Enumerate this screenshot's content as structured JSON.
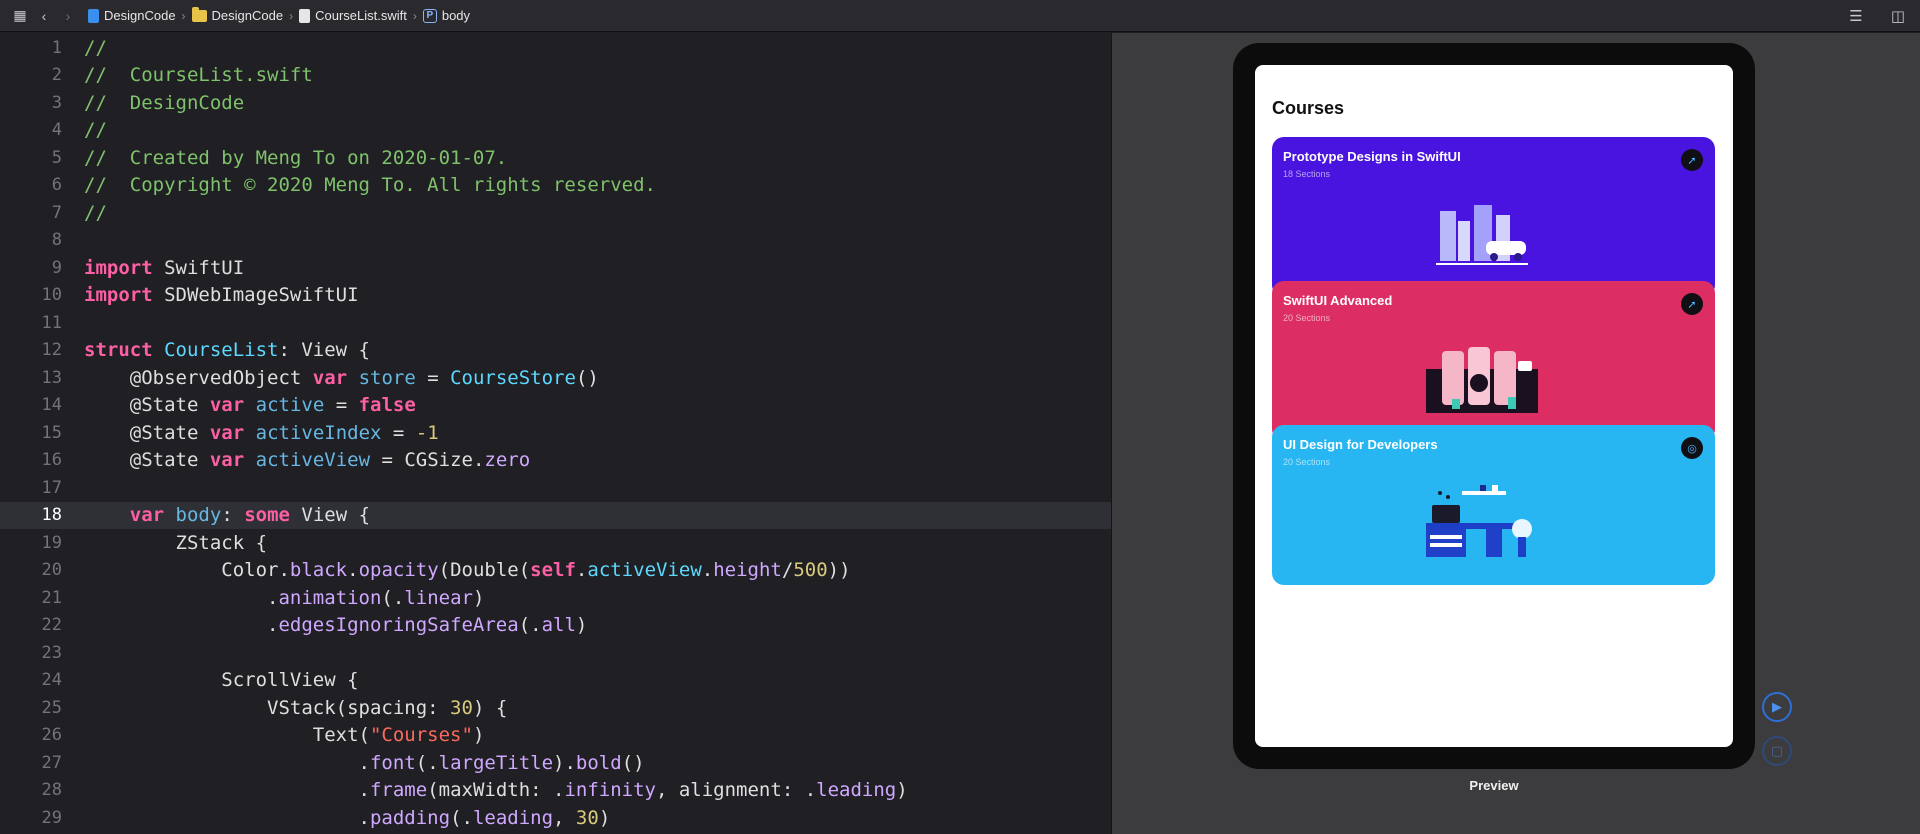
{
  "toolbar": {
    "breadcrumbs": [
      {
        "label": "DesignCode",
        "icon": "swift-project-icon"
      },
      {
        "label": "DesignCode",
        "icon": "folder-icon"
      },
      {
        "label": "CourseList.swift",
        "icon": "swift-file-icon"
      },
      {
        "label": "body",
        "icon": "property-icon"
      }
    ]
  },
  "editor": {
    "current_line": 18,
    "lines": [
      {
        "n": "1",
        "tokens": [
          [
            "cm",
            "//"
          ]
        ]
      },
      {
        "n": "2",
        "tokens": [
          [
            "cm",
            "//  CourseList.swift"
          ]
        ]
      },
      {
        "n": "3",
        "tokens": [
          [
            "cm",
            "//  DesignCode"
          ]
        ]
      },
      {
        "n": "4",
        "tokens": [
          [
            "cm",
            "//"
          ]
        ]
      },
      {
        "n": "5",
        "tokens": [
          [
            "cm",
            "//  Created by Meng To on 2020-01-07."
          ]
        ]
      },
      {
        "n": "6",
        "tokens": [
          [
            "cm",
            "//  Copyright © 2020 Meng To. All rights reserved."
          ]
        ]
      },
      {
        "n": "7",
        "tokens": [
          [
            "cm",
            "//"
          ]
        ]
      },
      {
        "n": "8",
        "tokens": []
      },
      {
        "n": "9",
        "tokens": [
          [
            "kw",
            "import"
          ],
          [
            "pl",
            " SwiftUI"
          ]
        ]
      },
      {
        "n": "10",
        "tokens": [
          [
            "kw",
            "import"
          ],
          [
            "pl",
            " SDWebImageSwiftUI"
          ]
        ]
      },
      {
        "n": "11",
        "tokens": []
      },
      {
        "n": "12",
        "tokens": [
          [
            "kw",
            "struct"
          ],
          [
            "pl",
            " "
          ],
          [
            "us",
            "CourseList"
          ],
          [
            "pl",
            ": View {"
          ]
        ]
      },
      {
        "n": "13",
        "tokens": [
          [
            "pl",
            "    @ObservedObject "
          ],
          [
            "kw",
            "var"
          ],
          [
            "pl",
            " "
          ],
          [
            "id",
            "store"
          ],
          [
            "pl",
            " = "
          ],
          [
            "us",
            "CourseStore"
          ],
          [
            "pl",
            "()"
          ]
        ]
      },
      {
        "n": "14",
        "tokens": [
          [
            "pl",
            "    @State "
          ],
          [
            "kw",
            "var"
          ],
          [
            "pl",
            " "
          ],
          [
            "id",
            "active"
          ],
          [
            "pl",
            " = "
          ],
          [
            "kw",
            "false"
          ]
        ]
      },
      {
        "n": "15",
        "tokens": [
          [
            "pl",
            "    @State "
          ],
          [
            "kw",
            "var"
          ],
          [
            "pl",
            " "
          ],
          [
            "id",
            "activeIndex"
          ],
          [
            "pl",
            " = "
          ],
          [
            "nm",
            "-1"
          ]
        ]
      },
      {
        "n": "16",
        "tokens": [
          [
            "pl",
            "    @State "
          ],
          [
            "kw",
            "var"
          ],
          [
            "pl",
            " "
          ],
          [
            "id",
            "activeView"
          ],
          [
            "pl",
            " = CGSize."
          ],
          [
            "tp",
            "zero"
          ]
        ]
      },
      {
        "n": "17",
        "tokens": []
      },
      {
        "n": "18",
        "tokens": [
          [
            "pl",
            "    "
          ],
          [
            "kw",
            "var"
          ],
          [
            "pl",
            " "
          ],
          [
            "id",
            "body"
          ],
          [
            "pl",
            ": "
          ],
          [
            "kw",
            "some"
          ],
          [
            "pl",
            " View {"
          ]
        ]
      },
      {
        "n": "19",
        "tokens": [
          [
            "pl",
            "        ZStack {"
          ]
        ]
      },
      {
        "n": "20",
        "tokens": [
          [
            "pl",
            "            Color."
          ],
          [
            "tp",
            "black"
          ],
          [
            "pl",
            "."
          ],
          [
            "tp",
            "opacity"
          ],
          [
            "pl",
            "(Double("
          ],
          [
            "kw",
            "self"
          ],
          [
            "pl",
            "."
          ],
          [
            "us",
            "activeView"
          ],
          [
            "pl",
            "."
          ],
          [
            "tp",
            "height"
          ],
          [
            "pl",
            "/"
          ],
          [
            "nm",
            "500"
          ],
          [
            "pl",
            "))"
          ]
        ]
      },
      {
        "n": "21",
        "tokens": [
          [
            "pl",
            "                ."
          ],
          [
            "tp",
            "animation"
          ],
          [
            "pl",
            "(."
          ],
          [
            "tp",
            "linear"
          ],
          [
            "pl",
            ")"
          ]
        ]
      },
      {
        "n": "22",
        "tokens": [
          [
            "pl",
            "                ."
          ],
          [
            "tp",
            "edgesIgnoringSafeArea"
          ],
          [
            "pl",
            "(."
          ],
          [
            "tp",
            "all"
          ],
          [
            "pl",
            ")"
          ]
        ]
      },
      {
        "n": "23",
        "tokens": []
      },
      {
        "n": "24",
        "tokens": [
          [
            "pl",
            "            ScrollView {"
          ]
        ]
      },
      {
        "n": "25",
        "tokens": [
          [
            "pl",
            "                VStack(spacing: "
          ],
          [
            "nm",
            "30"
          ],
          [
            "pl",
            ") {"
          ]
        ]
      },
      {
        "n": "26",
        "tokens": [
          [
            "pl",
            "                    Text("
          ],
          [
            "st",
            "\"Courses\""
          ],
          [
            "pl",
            ")"
          ]
        ]
      },
      {
        "n": "27",
        "tokens": [
          [
            "pl",
            "                        ."
          ],
          [
            "tp",
            "font"
          ],
          [
            "pl",
            "(."
          ],
          [
            "tp",
            "largeTitle"
          ],
          [
            "pl",
            ")."
          ],
          [
            "tp",
            "bold"
          ],
          [
            "pl",
            "()"
          ]
        ]
      },
      {
        "n": "28",
        "tokens": [
          [
            "pl",
            "                        ."
          ],
          [
            "tp",
            "frame"
          ],
          [
            "pl",
            "(maxWidth: ."
          ],
          [
            "tp",
            "infinity"
          ],
          [
            "pl",
            ", alignment: ."
          ],
          [
            "tp",
            "leading"
          ],
          [
            "pl",
            ")"
          ]
        ]
      },
      {
        "n": "29",
        "tokens": [
          [
            "pl",
            "                        ."
          ],
          [
            "tp",
            "padding"
          ],
          [
            "pl",
            "(."
          ],
          [
            "tp",
            "leading"
          ],
          [
            "pl",
            ", "
          ],
          [
            "nm",
            "30"
          ],
          [
            "pl",
            ")"
          ]
        ]
      }
    ]
  },
  "preview": {
    "screen_title": "Courses",
    "caption": "Preview",
    "cards": [
      {
        "title": "Prototype Designs in SwiftUI",
        "subtitle": "18 Sections",
        "color": "#4a14e0",
        "icon": "swift-logo-icon"
      },
      {
        "title": "SwiftUI Advanced",
        "subtitle": "20 Sections",
        "color": "#dd2e63",
        "icon": "swift-logo-icon"
      },
      {
        "title": "UI Design for Developers",
        "subtitle": "20 Sections",
        "color": "#28b6f2",
        "icon": "figma-logo-icon"
      }
    ]
  }
}
